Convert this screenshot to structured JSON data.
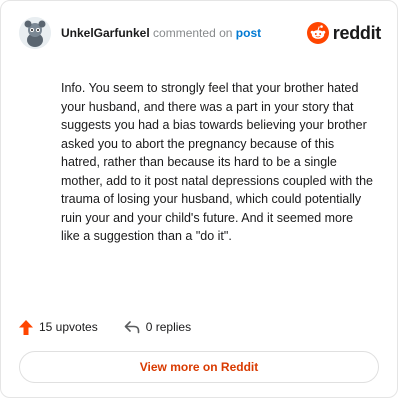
{
  "header": {
    "author": "UnkelGarfunkel",
    "verb": "commented on",
    "post_link": "post",
    "brand_name": "reddit",
    "brand_color": "#ff4500"
  },
  "comment": {
    "body": "Info. You seem to strongly feel that your brother hated your husband, and there was a part in your story that suggests you had a bias towards believing your brother asked you to abort the pregnancy because of this hatred, rather than because its hard to be a single mother, add to it post natal depressions coupled with the trauma of losing your husband, which could potentially ruin your and your child's future. And it seemed more like a suggestion than a \"do it\"."
  },
  "actions": {
    "upvotes_label": "15 upvotes",
    "replies_label": "0 replies",
    "upvote_icon": "upvote-arrow-icon",
    "reply_icon": "reply-arrow-icon"
  },
  "footer": {
    "view_more_label": "View more on Reddit",
    "accent_color": "#d93a00"
  }
}
